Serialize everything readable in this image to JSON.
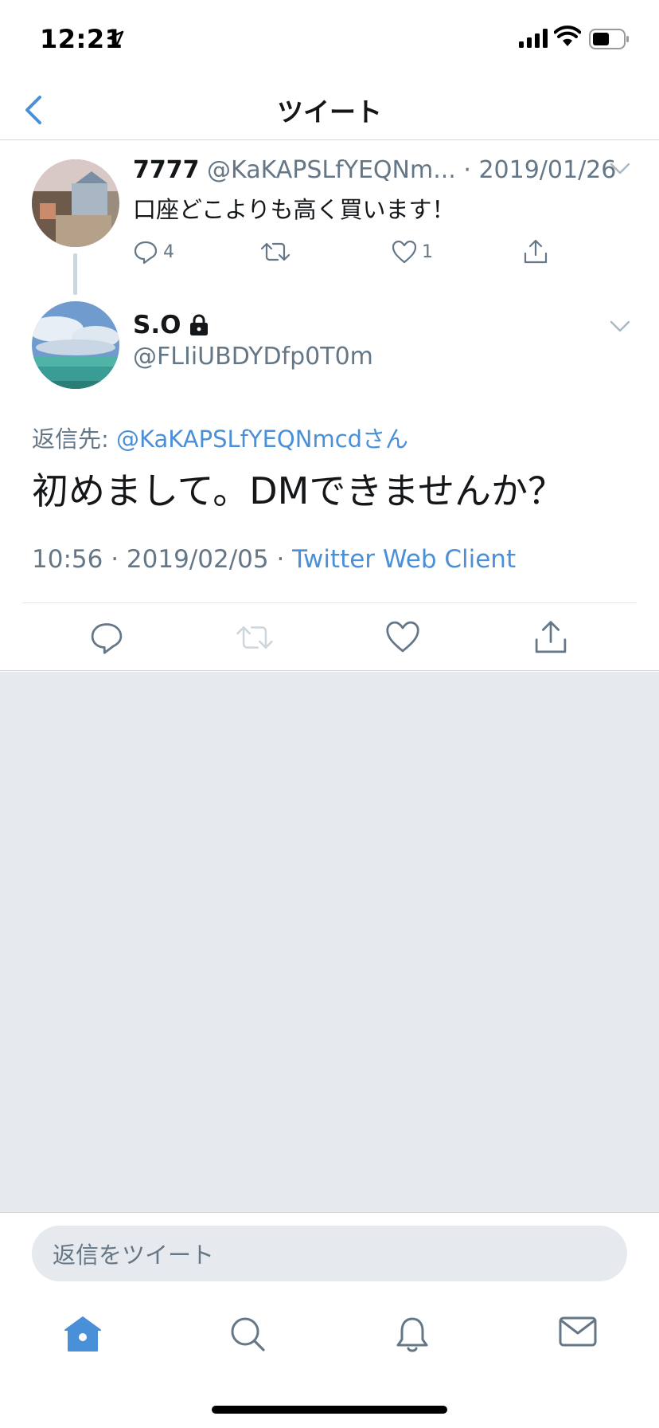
{
  "status_bar": {
    "time": "12:21"
  },
  "nav": {
    "title": "ツイート"
  },
  "parent_tweet": {
    "name": "7777",
    "handle": "@KaKAPSLfYEQNm...",
    "separator": " · ",
    "date": "2019/01/26",
    "text": "口座どこよりも高く買います！",
    "reply_count": "4",
    "like_count": "1"
  },
  "main_tweet": {
    "name": "S.O",
    "handle": "@FLIiUBDYDfp0T0m",
    "reply_prefix": "返信先: ",
    "reply_target": "@KaKAPSLfYEQNmcdさん",
    "text": "初めまして。DMできませんか？",
    "time": "10:56",
    "date": "2019/02/05",
    "separator": " · ",
    "client": "Twitter Web Client"
  },
  "composer": {
    "placeholder": "返信をツイート"
  },
  "colors": {
    "accent": "#4a90d9",
    "muted": "#657786",
    "background_gray": "#e6e9ed"
  },
  "icons": {
    "back": "chevron-left-icon",
    "location": "location-arrow-icon",
    "signal": "signal-icon",
    "wifi": "wifi-icon",
    "battery": "battery-icon",
    "reply": "reply-icon",
    "retweet": "retweet-icon",
    "like": "heart-icon",
    "share": "share-icon",
    "lock": "lock-icon",
    "home": "home-icon",
    "search": "search-icon",
    "notifications": "bell-icon",
    "messages": "mail-icon"
  }
}
